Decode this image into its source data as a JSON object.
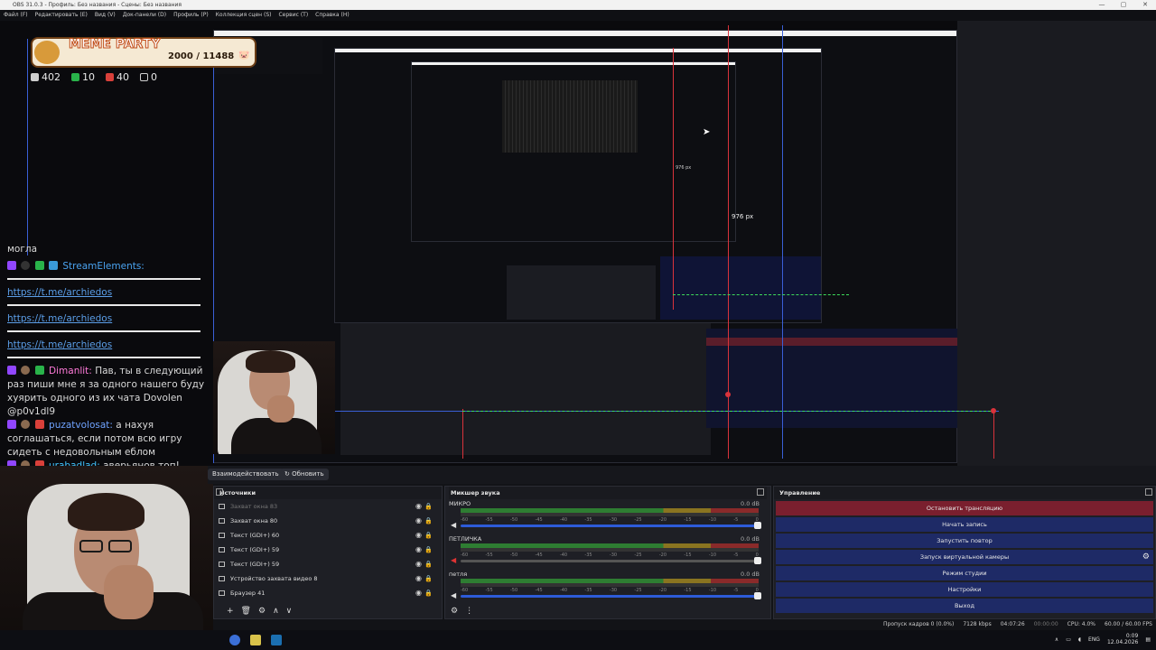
{
  "window": {
    "title": "OBS 31.0.3 - Профиль: Без названия - Сцены: Без названия",
    "controls": [
      "—",
      "▢",
      "✕"
    ]
  },
  "menu": [
    "Файл (F)",
    "Редактировать (E)",
    "Вид (V)",
    "Док-панели (D)",
    "Профиль (P)",
    "Коллекция сцен (S)",
    "Сервис (T)",
    "Справка (H)"
  ],
  "meme_widget": {
    "title": "MEME PARTY",
    "score": "2000 / 11488"
  },
  "stats": [
    {
      "icon": "chat-icon",
      "value": "402",
      "color": "#cfcfcf"
    },
    {
      "icon": "green-badge-icon",
      "value": "10",
      "color": "#29b34a"
    },
    {
      "icon": "red-badge-icon",
      "value": "40",
      "color": "#d9403a"
    },
    {
      "icon": "w-icon",
      "value": "0",
      "color": "#cfcfcf"
    }
  ],
  "chat": {
    "top_text": "могла",
    "se_name": "StreamElements:",
    "links": [
      "https://t.me/archiedos",
      "https://t.me/archiedos",
      "https://t.me/archiedos"
    ],
    "m1_name": "Dimanlit:",
    "m1_text": "Пав, ты в следующий раз пиши мне я за одного нашего буду хуярить одного из их чата Dovolen @p0v1dl9",
    "m2_name": "puzatvolosat:",
    "m2_text": "а нахуя соглашаться, если потом всю игру сидеть с недовольным еблом",
    "m3_name": "urabadlad:",
    "m3_text": "аверьянов топ!"
  },
  "toolbar": {
    "interact": "Взаимодействовать",
    "refresh": "Обновить"
  },
  "sources": {
    "title": "Источники",
    "items": [
      {
        "label": "Захват окна 83",
        "dim": true
      },
      {
        "label": "Захват окна 80",
        "dim": false
      },
      {
        "label": "Текст (GDI+) 60",
        "dim": false
      },
      {
        "label": "Текст (GDI+) 59",
        "dim": false
      },
      {
        "label": "Текст (GDI+) 59",
        "dim": false
      },
      {
        "label": "Устройство захвата видео 8",
        "dim": false
      },
      {
        "label": "Браузер 41",
        "dim": false
      }
    ]
  },
  "mixer": {
    "title": "Микшер звука",
    "ticks": [
      "-60",
      "-55",
      "-50",
      "-45",
      "-40",
      "-35",
      "-30",
      "-25",
      "-20",
      "-15",
      "-10",
      "-5",
      "0"
    ],
    "channels": [
      {
        "name": "МИКРО",
        "db": "0.0 dB",
        "muted": false
      },
      {
        "name": "ПЕТЛИЧКА",
        "db": "0.0 dB",
        "muted": true
      },
      {
        "name": "петля",
        "db": "0.0 dB",
        "muted": false
      }
    ]
  },
  "controls": {
    "title": "Управление",
    "buttons": [
      {
        "label": "Остановить трансляцию",
        "style": "red"
      },
      {
        "label": "Начать запись",
        "style": "blue"
      },
      {
        "label": "Запустить повтор",
        "style": "blue"
      },
      {
        "label": "Запуск виртуальной камеры",
        "style": "blue",
        "gear": true
      },
      {
        "label": "Режим студии",
        "style": "blue"
      },
      {
        "label": "Настройки",
        "style": "blue"
      },
      {
        "label": "Выход",
        "style": "blue"
      }
    ]
  },
  "status": {
    "dropped": "Пропуск кадров 0 (0.0%)",
    "bitrate": "7128 kbps",
    "stream_time": "04:07:26",
    "rec_time": "00:00:00",
    "cpu": "CPU: 4.0%",
    "fps": "60.00 / 60.00 FPS"
  },
  "tray": {
    "lang": "ENG",
    "time": "0:09",
    "date": "12.04.2026"
  },
  "preview_labels": {
    "px1": "976 px",
    "px2": "976 px"
  }
}
